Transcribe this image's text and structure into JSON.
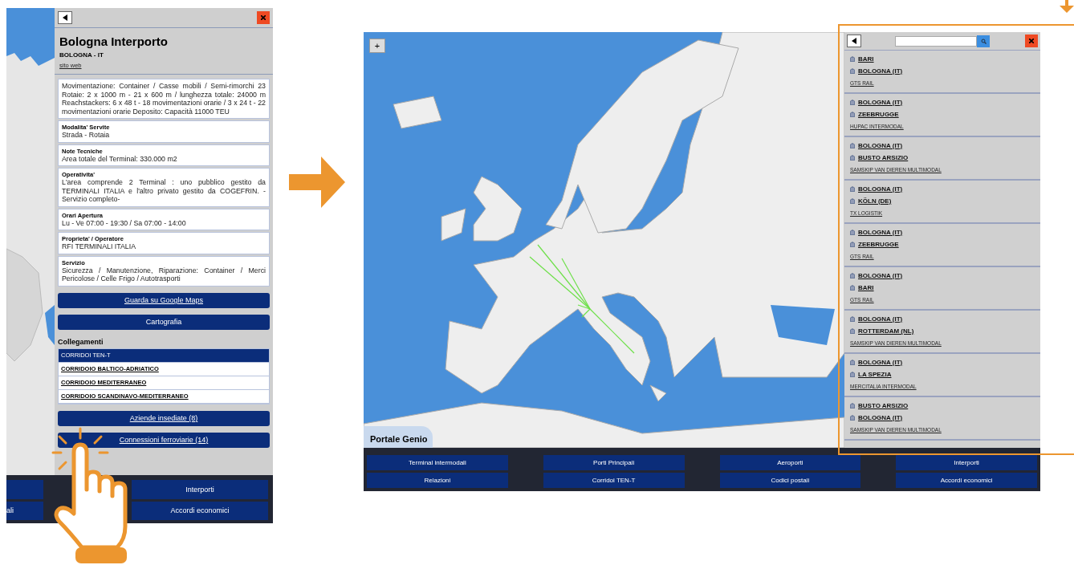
{
  "left_screen": {
    "title": "Bologna Interporto",
    "subtitle": "BOLOGNA - IT",
    "website_link": "sito web",
    "description": "Movimentazione: Container / Casse mobili / Semi-rimorchi 23 Rotaie: 2 x 1000 m - 21 x 600 m / lunghezza totale: 24000 m Reachstackers: 6 x 48 t - 18 movimentazioni orarie / 3 x 24 t - 22 movimentazioni orarie Deposito: Capacità 11000 TEU",
    "info_sections": [
      {
        "label": "Modalita' Servite",
        "value": "Strada - Rotaia"
      },
      {
        "label": "Note Tecniche",
        "value": "Area totale del Terminal: 330.000 m2"
      },
      {
        "label": "Operativita'",
        "value": "L'area comprende 2 Terminal : uno pubblico gestito da TERMINALI ITALIA e l'altro privato gestito da COGEFRIN. - Servizio completo-"
      },
      {
        "label": "Orari Apertura",
        "value": "Lu - Ve 07:00 - 19:30 / Sa 07:00 - 14:00"
      },
      {
        "label": "Proprieta' / Operatore",
        "value": "RFI TERMINALI ITALIA"
      },
      {
        "label": "Servizio",
        "value": "Sicurezza / Manutenzione, Riparazione: Container / Merci Pericolose / Celle Frigo / Autotrasporti"
      }
    ],
    "buttons": [
      {
        "label": "Guarda su Google Maps",
        "kind": "link"
      },
      {
        "label": "Cartografia",
        "kind": "plain"
      }
    ],
    "links_heading": "Collegamenti",
    "links": [
      {
        "label": "CORRIDOI TEN-T",
        "kind": "header"
      },
      {
        "label": "CORRIDOIO BALTICO-ADRIATICO",
        "kind": "link"
      },
      {
        "label": "CORRIDOIO MEDITERRANEO",
        "kind": "link"
      },
      {
        "label": "CORRIDOIO SCANDINAVO-MEDITERRANEO",
        "kind": "link"
      }
    ],
    "action_buttons": [
      "Aziende insediate (8)",
      "Connessioni ferroviarie (14)"
    ],
    "bottom_nav": [
      "Interporti",
      "ali",
      "Accordi economici"
    ]
  },
  "right_screen": {
    "zoom_button": "+",
    "map_label": "Portale Genio",
    "results": [
      {
        "stations": [
          "BARI",
          "BOLOGNA (IT)"
        ],
        "operator": "GTS RAIL"
      },
      {
        "stations": [
          "BOLOGNA (IT)",
          "ZEEBRUGGE"
        ],
        "operator": "HUPAC INTERMODAL"
      },
      {
        "stations": [
          "BOLOGNA (IT)",
          "BUSTO ARSIZIO"
        ],
        "operator": "SAMSKIP VAN DIEREN MULTIMODAL"
      },
      {
        "stations": [
          "BOLOGNA (IT)",
          "KÖLN (DE)"
        ],
        "operator": "TX LOGISTIK"
      },
      {
        "stations": [
          "BOLOGNA (IT)",
          "ZEEBRUGGE"
        ],
        "operator": "GTS RAIL"
      },
      {
        "stations": [
          "BOLOGNA (IT)",
          "BARI"
        ],
        "operator": "GTS RAIL"
      },
      {
        "stations": [
          "BOLOGNA (IT)",
          "ROTTERDAM (NL)"
        ],
        "operator": "SAMSKIP VAN DIEREN MULTIMODAL"
      },
      {
        "stations": [
          "BOLOGNA (IT)",
          "LA SPEZIA"
        ],
        "operator": "MERCITALIA INTERMODAL"
      },
      {
        "stations": [
          "BUSTO ARSIZIO",
          "BOLOGNA (IT)"
        ],
        "operator": "SAMSKIP VAN DIEREN MULTIMODAL"
      }
    ],
    "bottom_nav": [
      "Terminal intermodali",
      "Porti Principali",
      "Aeroporti",
      "Interporti",
      "Relazioni",
      "Corridoi TEN-T",
      "Codici postali",
      "Accordi economici"
    ]
  }
}
